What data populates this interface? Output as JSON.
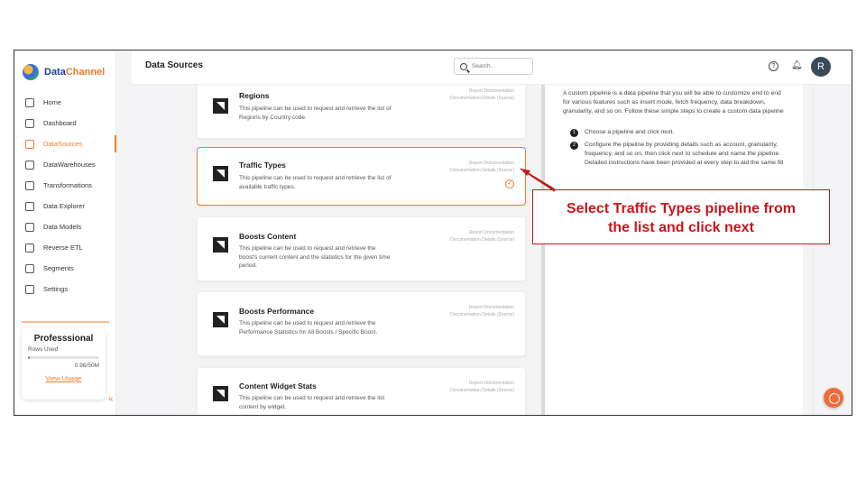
{
  "brand": {
    "name_a": "Data",
    "name_b": "Channel"
  },
  "sidebar": {
    "items": [
      {
        "label": "Home",
        "icon": "home-icon"
      },
      {
        "label": "Dashboard",
        "icon": "dashboard-icon"
      },
      {
        "label": "DataSources",
        "icon": "datasources-icon",
        "active": true
      },
      {
        "label": "DataWarehouses",
        "icon": "warehouse-icon"
      },
      {
        "label": "Transformations",
        "icon": "transform-icon"
      },
      {
        "label": "Data Explorer",
        "icon": "explorer-icon"
      },
      {
        "label": "Data Models",
        "icon": "models-icon"
      },
      {
        "label": "Reverse ETL",
        "icon": "reverse-etl-icon"
      },
      {
        "label": "Segments",
        "icon": "segments-icon"
      },
      {
        "label": "Settings",
        "icon": "settings-icon"
      }
    ],
    "plan": {
      "name": "Professsional",
      "rows_label": "Rows Used",
      "rows_count": "0.96/50M",
      "usage_fraction": 0.02,
      "link": "View Usage"
    },
    "collapse_glyph": "«"
  },
  "header": {
    "title": "Data Sources",
    "search_placeholder": "Search...",
    "help_glyph": "?",
    "bell_glyph": "♫",
    "avatar_initial": "R"
  },
  "pipelines": [
    {
      "title": "Regions",
      "desc": "This pipeline can be used to request and retrieve the list of Regions by Country code.",
      "doc1": "Report Documentation",
      "doc2": "Documentation Details (Source)"
    },
    {
      "title": "Traffic Types",
      "desc": "This pipeline can be used to request and retrieve the list of available traffic types.",
      "doc1": "Report Documentation",
      "doc2": "Documentation Details (Source)",
      "selected": true
    },
    {
      "title": "Boosts Content",
      "desc": "This pipeline can be used to request and retrieve the boost's current content and the statistics for the given time period.",
      "doc1": "Report Documentation",
      "doc2": "Documentation Details (Source)"
    },
    {
      "title": "Boosts Performance",
      "desc": "This pipeline can be used to request and retrieve the Performance Statistics for All Boosts / Specific Boost.",
      "doc1": "Report Documentation",
      "doc2": "Documentation Details (Source)"
    },
    {
      "title": "Content Widget Stats",
      "desc": "This pipeline can be used to request and retrieve the list content by widget.",
      "doc1": "Report Documentation",
      "doc2": "Documentation Details (Source)"
    }
  ],
  "panel": {
    "intro": "A custom pipeline is a data pipeline that you will be able to customize end to end for various features such as insert mode, fetch frequency, data breakdown, granularity, and so on. Follow these simple steps to create a custom data pipeline",
    "steps": [
      {
        "num": "1",
        "text": "Choose a pipeline and click next."
      },
      {
        "num": "2",
        "text": "Configure the pipeline by providing details such as account, granularity, frequency, and so on, then click next to schedule and name the pipeline. Detailed instructions have been provided at every step to aid the same fill"
      }
    ]
  },
  "callout": {
    "line1": "Select Traffic Types pipeline from",
    "line2": "the list and click next",
    "color": "#c8161c"
  },
  "colors": {
    "accent": "#f07a2a",
    "callout": "#c01818"
  }
}
